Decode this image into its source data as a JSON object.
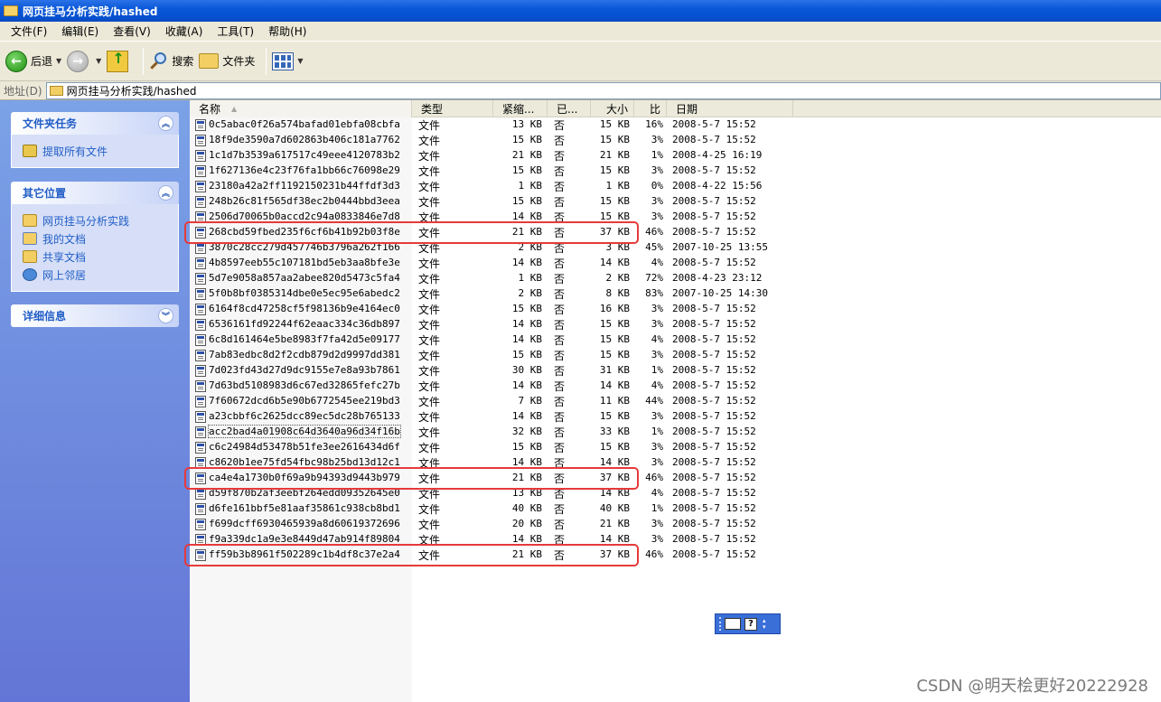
{
  "window": {
    "title": "网页挂马分析实践/hashed"
  },
  "menu": [
    "文件(F)",
    "编辑(E)",
    "查看(V)",
    "收藏(A)",
    "工具(T)",
    "帮助(H)"
  ],
  "toolbar": {
    "back": "后退",
    "search": "搜索",
    "folders": "文件夹"
  },
  "address": {
    "label": "地址(D)",
    "value": "网页挂马分析实践/hashed"
  },
  "left_panels": {
    "tasks": {
      "title": "文件夹任务",
      "items": [
        "提取所有文件"
      ]
    },
    "places": {
      "title": "其它位置",
      "items": [
        "网页挂马分析实践",
        "我的文档",
        "共享文档",
        "网上邻居"
      ]
    },
    "details": {
      "title": "详细信息"
    }
  },
  "columns": [
    "名称",
    "类型",
    "紧缩...",
    "已...",
    "大小",
    "比",
    "日期"
  ],
  "files": [
    {
      "name": "0c5abac0f26a574bafad01ebfa08cbfa",
      "type": "文件",
      "csize": "13 KB",
      "enc": "否",
      "size": "15 KB",
      "ratio": "16%",
      "date": "2008-5-7 15:52"
    },
    {
      "name": "18f9de3590a7d602863b406c181a7762",
      "type": "文件",
      "csize": "15 KB",
      "enc": "否",
      "size": "15 KB",
      "ratio": "3%",
      "date": "2008-5-7 15:52"
    },
    {
      "name": "1c1d7b3539a617517c49eee4120783b2",
      "type": "文件",
      "csize": "21 KB",
      "enc": "否",
      "size": "21 KB",
      "ratio": "1%",
      "date": "2008-4-25 16:19"
    },
    {
      "name": "1f627136e4c23f76fa1bb66c76098e29",
      "type": "文件",
      "csize": "15 KB",
      "enc": "否",
      "size": "15 KB",
      "ratio": "3%",
      "date": "2008-5-7 15:52"
    },
    {
      "name": "23180a42a2ff1192150231b44ffdf3d3",
      "type": "文件",
      "csize": "1 KB",
      "enc": "否",
      "size": "1 KB",
      "ratio": "0%",
      "date": "2008-4-22 15:56"
    },
    {
      "name": "248b26c81f565df38ec2b0444bbd3eea",
      "type": "文件",
      "csize": "15 KB",
      "enc": "否",
      "size": "15 KB",
      "ratio": "3%",
      "date": "2008-5-7 15:52"
    },
    {
      "name": "2506d70065b0accd2c94a0833846e7d8",
      "type": "文件",
      "csize": "14 KB",
      "enc": "否",
      "size": "15 KB",
      "ratio": "3%",
      "date": "2008-5-7 15:52"
    },
    {
      "name": "268cbd59fbed235f6cf6b41b92b03f8e",
      "type": "文件",
      "csize": "21 KB",
      "enc": "否",
      "size": "37 KB",
      "ratio": "46%",
      "date": "2008-5-7 15:52"
    },
    {
      "name": "3870c28cc279d457746b3796a262f166",
      "type": "文件",
      "csize": "2 KB",
      "enc": "否",
      "size": "3 KB",
      "ratio": "45%",
      "date": "2007-10-25 13:55"
    },
    {
      "name": "4b8597eeb55c107181bd5eb3aa8bfe3e",
      "type": "文件",
      "csize": "14 KB",
      "enc": "否",
      "size": "14 KB",
      "ratio": "4%",
      "date": "2008-5-7 15:52"
    },
    {
      "name": "5d7e9058a857aa2abee820d5473c5fa4",
      "type": "文件",
      "csize": "1 KB",
      "enc": "否",
      "size": "2 KB",
      "ratio": "72%",
      "date": "2008-4-23 23:12"
    },
    {
      "name": "5f0b8bf0385314dbe0e5ec95e6abedc2",
      "type": "文件",
      "csize": "2 KB",
      "enc": "否",
      "size": "8 KB",
      "ratio": "83%",
      "date": "2007-10-25 14:30"
    },
    {
      "name": "6164f8cd47258cf5f98136b9e4164ec0",
      "type": "文件",
      "csize": "15 KB",
      "enc": "否",
      "size": "16 KB",
      "ratio": "3%",
      "date": "2008-5-7 15:52"
    },
    {
      "name": "6536161fd92244f62eaac334c36db897",
      "type": "文件",
      "csize": "14 KB",
      "enc": "否",
      "size": "15 KB",
      "ratio": "3%",
      "date": "2008-5-7 15:52"
    },
    {
      "name": "6c8d161464e5be8983f7fa42d5e09177",
      "type": "文件",
      "csize": "14 KB",
      "enc": "否",
      "size": "15 KB",
      "ratio": "4%",
      "date": "2008-5-7 15:52"
    },
    {
      "name": "7ab83edbc8d2f2cdb879d2d9997dd381",
      "type": "文件",
      "csize": "15 KB",
      "enc": "否",
      "size": "15 KB",
      "ratio": "3%",
      "date": "2008-5-7 15:52"
    },
    {
      "name": "7d023fd43d27d9dc9155e7e8a93b7861",
      "type": "文件",
      "csize": "30 KB",
      "enc": "否",
      "size": "31 KB",
      "ratio": "1%",
      "date": "2008-5-7 15:52"
    },
    {
      "name": "7d63bd5108983d6c67ed32865fefc27b",
      "type": "文件",
      "csize": "14 KB",
      "enc": "否",
      "size": "14 KB",
      "ratio": "4%",
      "date": "2008-5-7 15:52"
    },
    {
      "name": "7f60672dcd6b5e90b6772545ee219bd3",
      "type": "文件",
      "csize": "7 KB",
      "enc": "否",
      "size": "11 KB",
      "ratio": "44%",
      "date": "2008-5-7 15:52"
    },
    {
      "name": "a23cbbf6c2625dcc89ec5dc28b765133",
      "type": "文件",
      "csize": "14 KB",
      "enc": "否",
      "size": "15 KB",
      "ratio": "3%",
      "date": "2008-5-7 15:52"
    },
    {
      "name": "acc2bad4a01908c64d3640a96d34f16b",
      "type": "文件",
      "csize": "32 KB",
      "enc": "否",
      "size": "33 KB",
      "ratio": "1%",
      "date": "2008-5-7 15:52"
    },
    {
      "name": "c6c24984d53478b51fe3ee2616434d6f",
      "type": "文件",
      "csize": "15 KB",
      "enc": "否",
      "size": "15 KB",
      "ratio": "3%",
      "date": "2008-5-7 15:52"
    },
    {
      "name": "c8620b1ee75fd54fbc98b25bd13d12c1",
      "type": "文件",
      "csize": "14 KB",
      "enc": "否",
      "size": "14 KB",
      "ratio": "3%",
      "date": "2008-5-7 15:52"
    },
    {
      "name": "ca4e4a1730b0f69a9b94393d9443b979",
      "type": "文件",
      "csize": "21 KB",
      "enc": "否",
      "size": "37 KB",
      "ratio": "46%",
      "date": "2008-5-7 15:52"
    },
    {
      "name": "d59f870b2af3eebf264edd09352645e0",
      "type": "文件",
      "csize": "13 KB",
      "enc": "否",
      "size": "14 KB",
      "ratio": "4%",
      "date": "2008-5-7 15:52"
    },
    {
      "name": "d6fe161bbf5e81aaf35861c938cb8bd1",
      "type": "文件",
      "csize": "40 KB",
      "enc": "否",
      "size": "40 KB",
      "ratio": "1%",
      "date": "2008-5-7 15:52"
    },
    {
      "name": "f699dcff6930465939a8d60619372696",
      "type": "文件",
      "csize": "20 KB",
      "enc": "否",
      "size": "21 KB",
      "ratio": "3%",
      "date": "2008-5-7 15:52"
    },
    {
      "name": "f9a339dc1a9e3e8449d47ab914f89804",
      "type": "文件",
      "csize": "14 KB",
      "enc": "否",
      "size": "14 KB",
      "ratio": "3%",
      "date": "2008-5-7 15:52"
    },
    {
      "name": "ff59b3b8961f502289c1b4df8c37e2a4",
      "type": "文件",
      "csize": "21 KB",
      "enc": "否",
      "size": "37 KB",
      "ratio": "46%",
      "date": "2008-5-7 15:52"
    }
  ],
  "focused_row": 20,
  "highlighted_rows": [
    7,
    23,
    28
  ],
  "highlight_color": "#e63a3a",
  "watermark": "CSDN @明天桧更好20222928"
}
